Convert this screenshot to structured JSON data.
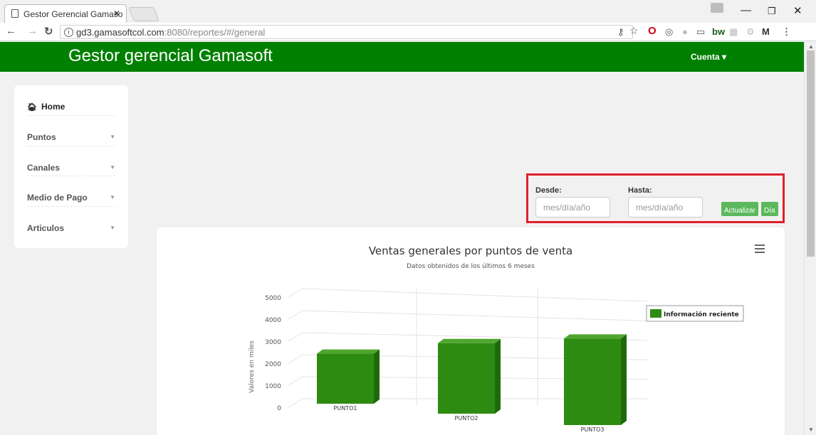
{
  "browser": {
    "tab_title": "Gestor Gerencial Gamaso",
    "url_host": "gd3.gamasoftcol.com",
    "url_path": ":8080/reportes/#/general"
  },
  "header": {
    "brand": "Gestor gerencial Gamasoft",
    "account_label": "Cuenta ▾"
  },
  "sidebar": {
    "items": [
      {
        "label": "Home",
        "icon": "home-icon"
      },
      {
        "label": "Puntos"
      },
      {
        "label": "Canales"
      },
      {
        "label": "Medio de Pago"
      },
      {
        "label": "Articulos"
      }
    ]
  },
  "filters": {
    "from_label": "Desde:",
    "to_label": "Hasta:",
    "from_placeholder": "mes/día/año",
    "to_placeholder": "mes/día/año",
    "update_button": "Actualizar",
    "day_button": "Día"
  },
  "chart_data": {
    "type": "bar",
    "title": "Ventas generales por puntos de venta",
    "subtitle": "Datos obtenidos de los últimos 6 meses",
    "ylabel": "Valores en miles",
    "xlabel": "",
    "categories": [
      "PUNTO1",
      "PUNTO2",
      "PUNTO3"
    ],
    "series": [
      {
        "name": "Información reciente",
        "values": [
          2200,
          3100,
          3800
        ]
      }
    ],
    "ylim": [
      0,
      5000
    ],
    "yticks": [
      0,
      1000,
      2000,
      3000,
      4000,
      5000
    ],
    "color": "#2e8b12",
    "legend": "top-right",
    "grid": true
  }
}
